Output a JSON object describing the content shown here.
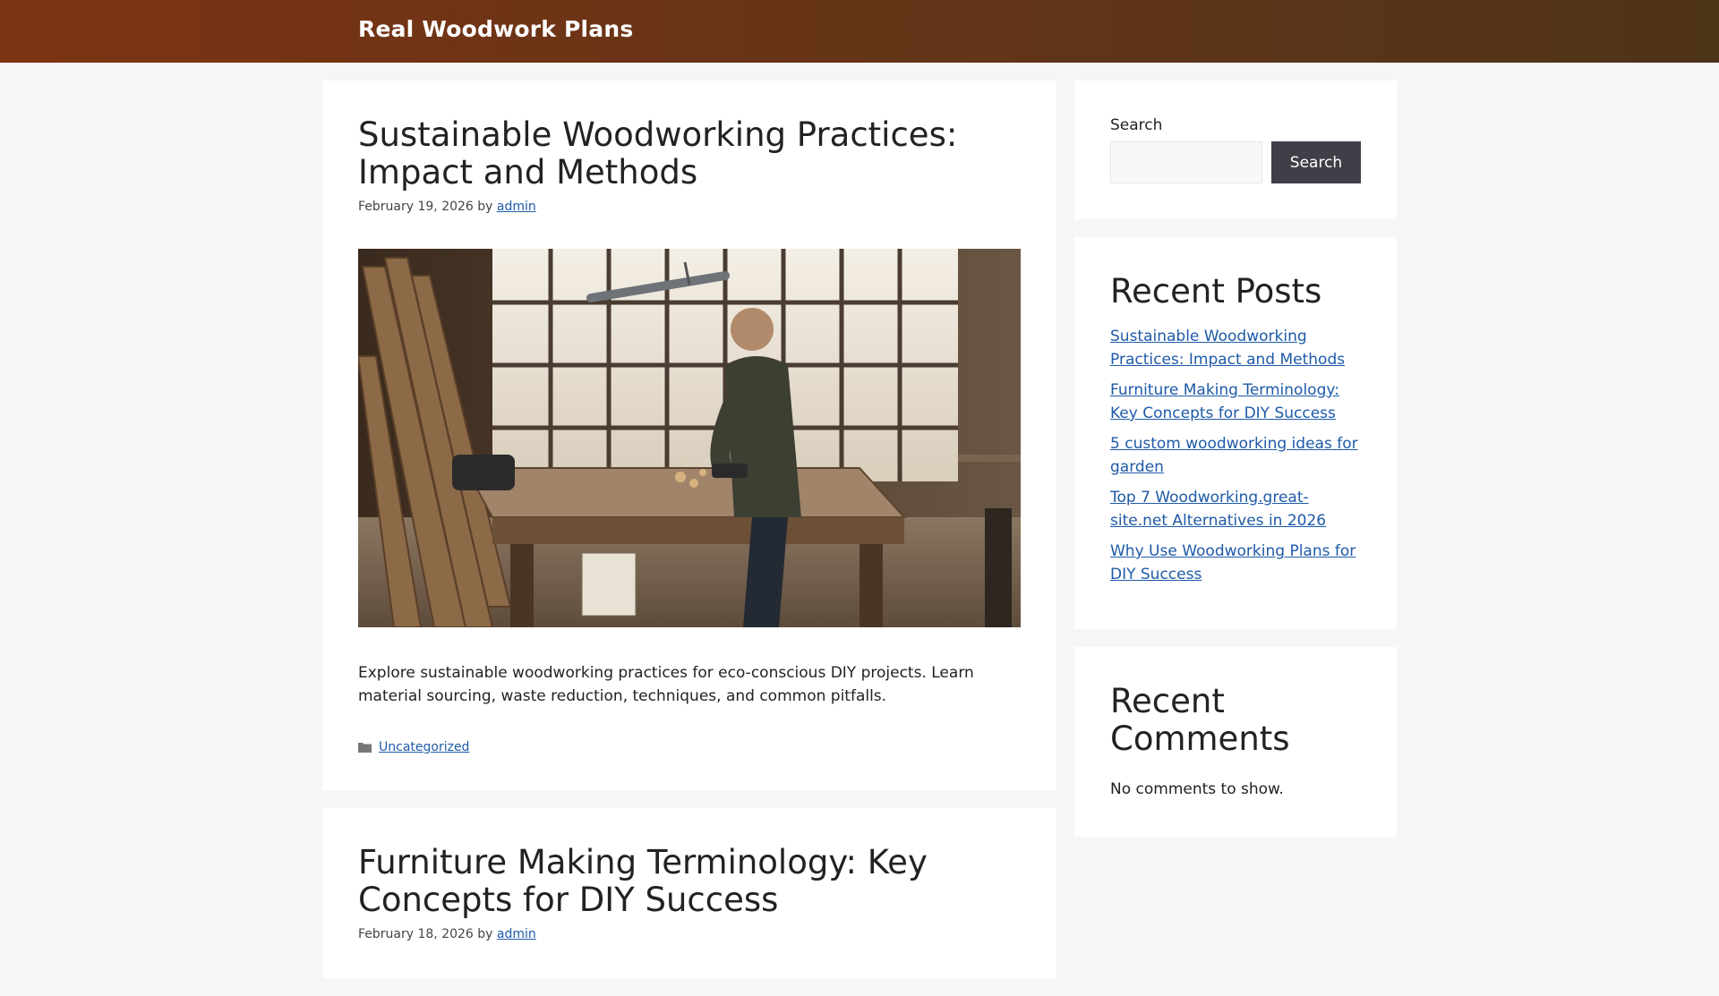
{
  "site": {
    "title": "Real Woodwork Plans"
  },
  "posts": [
    {
      "title": "Sustainable Woodworking Practices: Impact and Methods",
      "date": "February 19, 2026",
      "by": "by",
      "author": "admin",
      "excerpt": "Explore sustainable woodworking practices for eco-conscious DIY projects. Learn material sourcing, waste reduction, techniques, and common pitfalls.",
      "category": "Uncategorized"
    },
    {
      "title": "Furniture Making Terminology: Key Concepts for DIY Success",
      "date": "February 18, 2026",
      "by": "by",
      "author": "admin"
    }
  ],
  "sidebar": {
    "search": {
      "label": "Search",
      "placeholder": "",
      "button": "Search"
    },
    "recent_posts": {
      "title": "Recent Posts",
      "items": [
        "Sustainable Woodworking Practices: Impact and Methods",
        "Furniture Making Terminology: Key Concepts for DIY Success",
        "5 custom woodworking ideas for garden",
        "Top 7 Woodworking.great-site.net Alternatives in 2026",
        "Why Use Woodworking Plans for DIY Success"
      ]
    },
    "recent_comments": {
      "title": "Recent Comments",
      "empty": "No comments to show."
    }
  },
  "colors": {
    "header_start": "#7d3412",
    "header_end": "#4e3419",
    "link": "#1e5aa8",
    "button": "#3f4047"
  }
}
